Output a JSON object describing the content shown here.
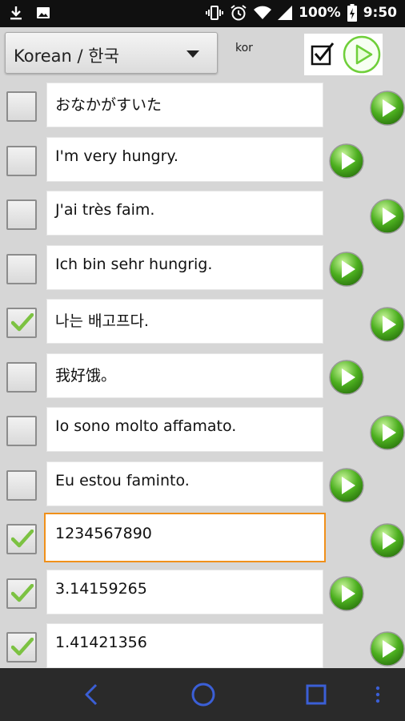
{
  "status_bar": {
    "battery": "100%",
    "time": "9:50"
  },
  "toolbar": {
    "language_label": "Korean / 한국",
    "language_code": "kor",
    "select_all_checked": true
  },
  "rows": [
    {
      "text": "おなかがすいた",
      "checked": false,
      "play_position": "far",
      "focused": false
    },
    {
      "text": "I'm very hungry.",
      "checked": false,
      "play_position": "near",
      "focused": false
    },
    {
      "text": "J'ai très faim.",
      "checked": false,
      "play_position": "far",
      "focused": false
    },
    {
      "text": "Ich bin sehr hungrig.",
      "checked": false,
      "play_position": "near",
      "focused": false
    },
    {
      "text": "나는 배고프다.",
      "checked": true,
      "play_position": "far",
      "focused": false
    },
    {
      "text": "我好饿。",
      "checked": false,
      "play_position": "near",
      "focused": false
    },
    {
      "text": "Io sono molto affamato.",
      "checked": false,
      "play_position": "far",
      "focused": false
    },
    {
      "text": "Eu estou faminto.",
      "checked": false,
      "play_position": "near",
      "focused": false
    },
    {
      "text": "1234567890",
      "checked": true,
      "play_position": "far",
      "focused": true
    },
    {
      "text": "3.14159265",
      "checked": true,
      "play_position": "near",
      "focused": false
    },
    {
      "text": "1.41421356",
      "checked": true,
      "play_position": "far",
      "focused": false
    }
  ],
  "navigation": [
    "back-icon",
    "home-icon",
    "recents-icon",
    "overflow-menu-icon"
  ],
  "colors": {
    "accent_orange": "#f0901a",
    "check_green": "#7cc242",
    "play_green": "#4caf1f"
  }
}
